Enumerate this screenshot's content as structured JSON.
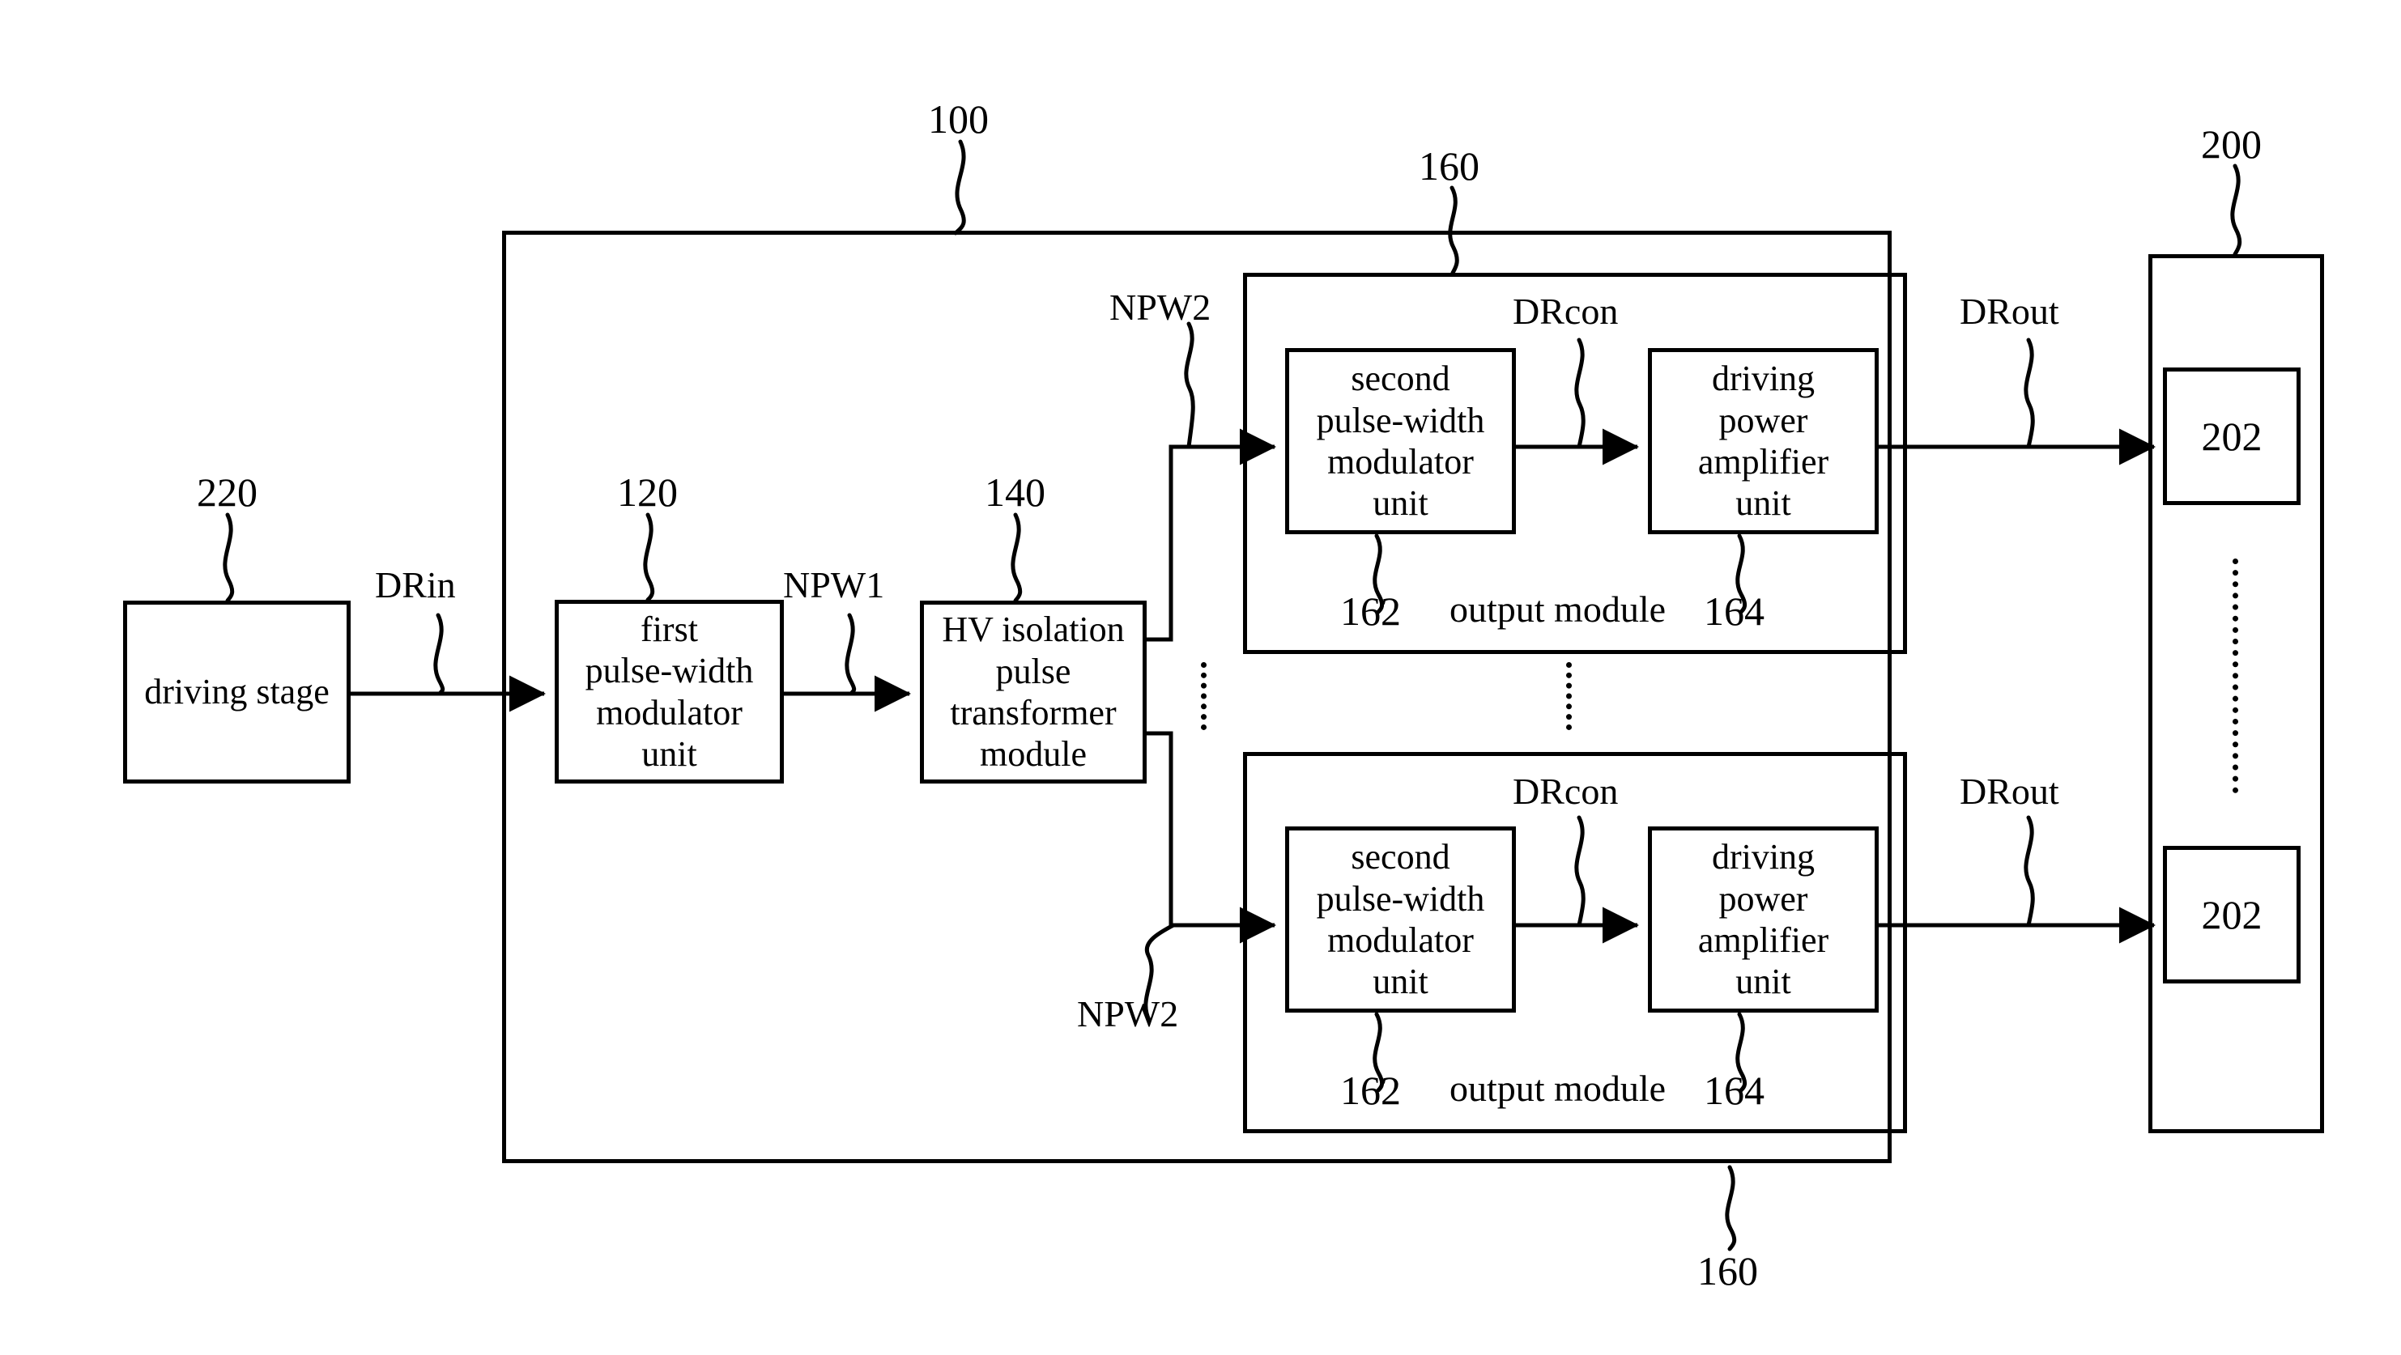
{
  "diagram": {
    "title": "driving apparatus block diagram",
    "line_color": "#000000",
    "background": "#ffffff"
  },
  "blocks": {
    "driving_stage": {
      "label": "driving stage",
      "ref": "220"
    },
    "first_pwm": {
      "label": "first\npulse-width\nmodulator\nunit",
      "ref": "120"
    },
    "hv_transformer": {
      "label": "HV isolation\npulse\ntransformer\nmodule",
      "ref": "140"
    },
    "system": {
      "ref": "100"
    },
    "output_module_top": {
      "ref": "160",
      "label": "output module"
    },
    "output_module_bottom": {
      "ref": "160",
      "label": "output module"
    },
    "second_pwm_top": {
      "label": "second\npulse-width\nmodulator\nunit",
      "ref": "162"
    },
    "driving_amp_top": {
      "label": "driving\npower\namplifier\nunit",
      "ref": "164"
    },
    "second_pwm_bottom": {
      "label": "second\npulse-width\nmodulator\nunit",
      "ref": "162"
    },
    "driving_amp_bottom": {
      "label": "driving\npower\namplifier\nunit",
      "ref": "164"
    },
    "load_panel": {
      "ref": "200"
    },
    "load_top": {
      "label": "202"
    },
    "load_bottom": {
      "label": "202"
    }
  },
  "signals": {
    "drin": "DRin",
    "npw1": "NPW1",
    "npw2_top": "NPW2",
    "npw2_bottom": "NPW2",
    "drcon_top": "DRcon",
    "drcon_bottom": "DRcon",
    "drout_top": "DRout",
    "drout_bottom": "DRout"
  },
  "refs": {
    "r100": "100",
    "r120": "120",
    "r140": "140",
    "r160_top": "160",
    "r160_bottom": "160",
    "r162_top": "162",
    "r164_top": "164",
    "r162_bottom": "162",
    "r164_bottom": "164",
    "r200": "200",
    "r220": "220"
  }
}
